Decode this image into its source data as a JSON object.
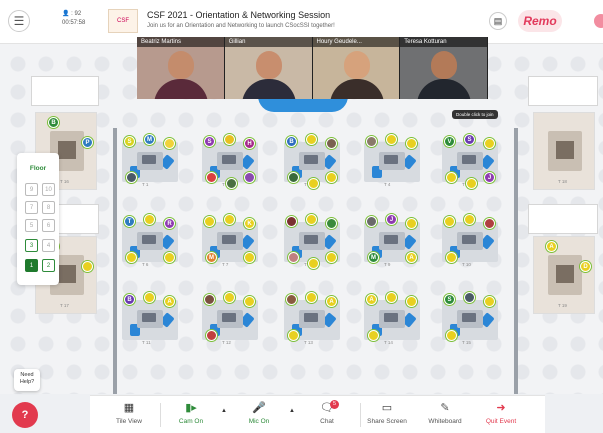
{
  "header": {
    "menu_icon": "hamburger-icon",
    "attendee_count": "92",
    "timer": "00:57:58",
    "event_thumb_text": "CSF",
    "title": "CSF 2021 - Orientation & Networking Session",
    "subtitle": "Join us for an Orientation and Networking to launch CSocSSI together!",
    "brand": "Remo"
  },
  "video_tiles": [
    {
      "name": "Beatriz Martins",
      "bg": "#b79a8e",
      "skin": "#c48c6c",
      "shirt": "#5a2a3a"
    },
    {
      "name": "Gillian",
      "bg": "#c9b9a6",
      "skin": "#c88e6e",
      "shirt": "#2c2c3a"
    },
    {
      "name": "Houry Geudele...",
      "bg": "#c7b59b",
      "skin": "#d6a27c",
      "shirt": "#3a2e2a"
    },
    {
      "name": "Teresa Kotturan",
      "bg": "#6f7072",
      "skin": "#b37a58",
      "shirt": "#22262e"
    }
  ],
  "hint": "Double click to join",
  "floor_panel": {
    "title": "Floor",
    "buttons": [
      "9",
      "10",
      "7",
      "8",
      "5",
      "6",
      "3",
      "4",
      "1",
      "2"
    ],
    "active": "1"
  },
  "tables": [
    {
      "label": "T 1",
      "avatars": [
        {
          "t": "S",
          "c": "#d9d321"
        },
        {
          "t": "M",
          "c": "#2e7bbf"
        },
        {
          "t": "",
          "c": "#f0d23a"
        },
        {
          "t": "",
          "c": "#4a5a66"
        }
      ]
    },
    {
      "label": "T 2",
      "avatars": [
        {
          "t": "S",
          "c": "#8e3ab0"
        },
        {
          "t": "",
          "c": "#e8c020"
        },
        {
          "t": "H",
          "c": "#a52a8a"
        },
        {
          "t": "",
          "c": "#d84040"
        },
        {
          "t": "",
          "c": "#8a4ab0"
        },
        {
          "t": "",
          "c": "#4a7040"
        }
      ]
    },
    {
      "label": "T 3",
      "avatars": [
        {
          "t": "B",
          "c": "#2e6dbf"
        },
        {
          "t": "",
          "c": "#e8d020"
        },
        {
          "t": "",
          "c": "#7a6050"
        },
        {
          "t": "",
          "c": "#3a6a3a"
        },
        {
          "t": "",
          "c": "#e8d020"
        },
        {
          "t": "",
          "c": "#e8d020"
        }
      ]
    },
    {
      "label": "T 4",
      "avatars": [
        {
          "t": "",
          "c": "#8a7a6a"
        },
        {
          "t": "",
          "c": "#e8d020"
        },
        {
          "t": "",
          "c": "#e8d020"
        }
      ]
    },
    {
      "label": "T 5",
      "avatars": [
        {
          "t": "V",
          "c": "#2e8b3a"
        },
        {
          "t": "S",
          "c": "#6a3ab0"
        },
        {
          "t": "",
          "c": "#e8d020"
        },
        {
          "t": "",
          "c": "#e8d020"
        },
        {
          "t": "J",
          "c": "#8e3ab0"
        },
        {
          "t": "",
          "c": "#e8d020"
        }
      ]
    },
    {
      "label": "T 6",
      "avatars": [
        {
          "t": "T",
          "c": "#2e7bbf"
        },
        {
          "t": "",
          "c": "#e8d020"
        },
        {
          "t": "R",
          "c": "#8e3ab0"
        },
        {
          "t": "",
          "c": "#e8d020"
        },
        {
          "t": "",
          "c": "#e8d020"
        }
      ]
    },
    {
      "label": "T 7",
      "avatars": [
        {
          "t": "",
          "c": "#e8d020"
        },
        {
          "t": "",
          "c": "#e8d020"
        },
        {
          "t": "K",
          "c": "#e8d020"
        },
        {
          "t": "M",
          "c": "#e08030"
        },
        {
          "t": "",
          "c": "#e8d020"
        }
      ]
    },
    {
      "label": "T 8",
      "avatars": [
        {
          "t": "",
          "c": "#7a3030"
        },
        {
          "t": "",
          "c": "#e8d020"
        },
        {
          "t": "",
          "c": "#3a8a3a"
        },
        {
          "t": "",
          "c": "#c08080"
        },
        {
          "t": "",
          "c": "#e8d020"
        },
        {
          "t": "",
          "c": "#e8d020"
        }
      ]
    },
    {
      "label": "T 9",
      "avatars": [
        {
          "t": "",
          "c": "#6a6a6a"
        },
        {
          "t": "J",
          "c": "#8e3ab0"
        },
        {
          "t": "",
          "c": "#e8d020"
        },
        {
          "t": "M",
          "c": "#2e8b3a"
        },
        {
          "t": "A",
          "c": "#e8d020"
        }
      ]
    },
    {
      "label": "T 10",
      "avatars": [
        {
          "t": "",
          "c": "#e8d020"
        },
        {
          "t": "",
          "c": "#e8d020"
        },
        {
          "t": "",
          "c": "#b04040"
        },
        {
          "t": "",
          "c": "#e8d020"
        }
      ]
    },
    {
      "label": "T 11",
      "avatars": [
        {
          "t": "B",
          "c": "#6a3ab0"
        },
        {
          "t": "",
          "c": "#e8d020"
        },
        {
          "t": "A",
          "c": "#e8d020"
        }
      ]
    },
    {
      "label": "T 12",
      "avatars": [
        {
          "t": "",
          "c": "#7a5040"
        },
        {
          "t": "",
          "c": "#e8d020"
        },
        {
          "t": "",
          "c": "#e8d020"
        },
        {
          "t": "",
          "c": "#c04040"
        }
      ]
    },
    {
      "label": "T 13",
      "avatars": [
        {
          "t": "",
          "c": "#8a5a40"
        },
        {
          "t": "",
          "c": "#e8d020"
        },
        {
          "t": "A",
          "c": "#e8d020"
        },
        {
          "t": "",
          "c": "#e8d020"
        }
      ]
    },
    {
      "label": "T 14",
      "avatars": [
        {
          "t": "A",
          "c": "#e8d020"
        },
        {
          "t": "",
          "c": "#e8d020"
        },
        {
          "t": "",
          "c": "#e8d020"
        },
        {
          "t": "",
          "c": "#e8d020"
        }
      ]
    },
    {
      "label": "T 15",
      "avatars": [
        {
          "t": "S",
          "c": "#2e8b3a"
        },
        {
          "t": "",
          "c": "#4a5a66"
        },
        {
          "t": "",
          "c": "#e8d020"
        },
        {
          "t": "",
          "c": "#e8d020"
        }
      ]
    }
  ],
  "side_rooms": {
    "left_top": {
      "label": "T 16",
      "avatars": [
        {
          "t": "B",
          "c": "#2e8b3a"
        },
        {
          "t": "P",
          "c": "#2e7bbf"
        }
      ]
    },
    "left_bottom": {
      "label": "T 17",
      "avatars": [
        {
          "t": "S",
          "c": "#8e3ab0"
        },
        {
          "t": "",
          "c": "#e8d020"
        }
      ]
    },
    "right_top": {
      "label": "T 18",
      "avatars": []
    },
    "right_bottom": {
      "label": "T 19",
      "avatars": [
        {
          "t": "A",
          "c": "#e8d020"
        },
        {
          "t": "D",
          "c": "#e8d020"
        }
      ]
    }
  },
  "help": {
    "text_line1": "Need",
    "text_line2": "Help?"
  },
  "toolbar": {
    "tile_view": "Tile View",
    "cam_on": "Cam On",
    "mic_on": "Mic On",
    "chat": "Chat",
    "chat_badge": "5",
    "share_screen": "Share Screen",
    "whiteboard": "Whiteboard",
    "quit_event": "Quit Event"
  },
  "colors": {
    "accent_green": "#2e8b3a",
    "brand_red": "#e23a4e",
    "chair_blue": "#2b86d6"
  }
}
